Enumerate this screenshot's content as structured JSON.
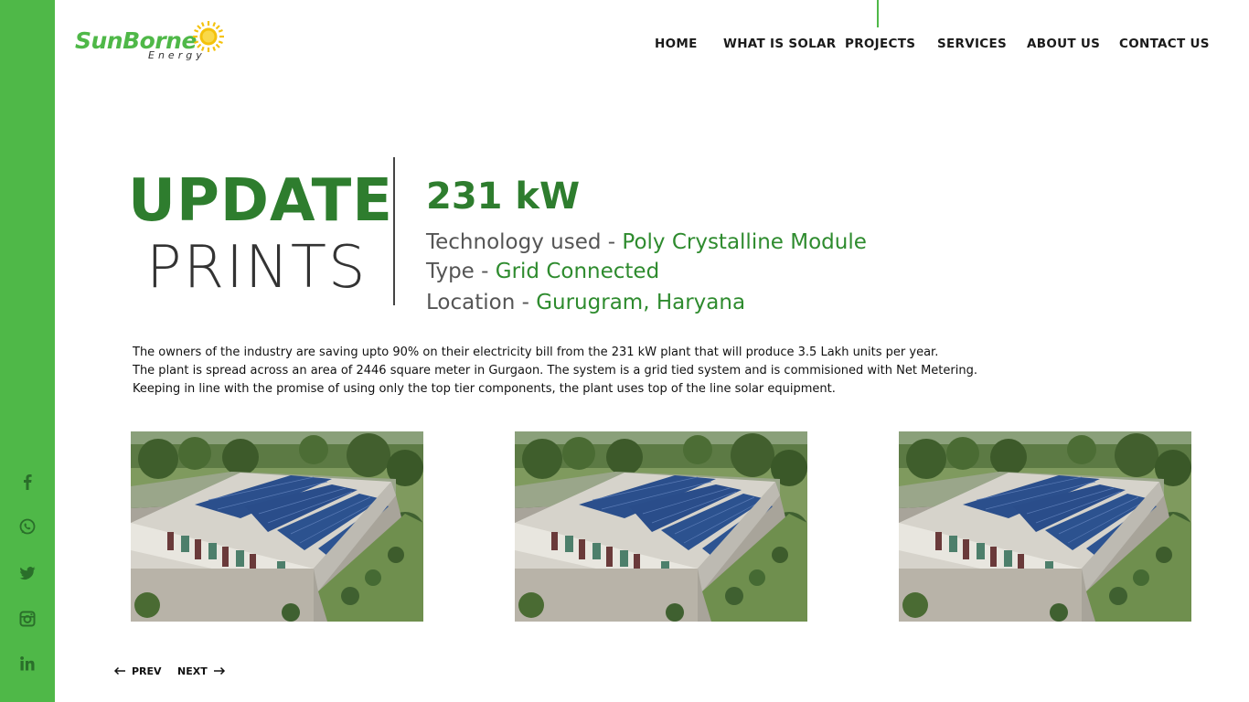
{
  "brand": {
    "name": "SunBorne",
    "tagline": "Energy",
    "accent": "#4fb848",
    "dark_green": "#2e7d2e"
  },
  "nav": [
    {
      "label": "HOME"
    },
    {
      "label": "WHAT IS SOLAR"
    },
    {
      "label": "PROJECTS"
    },
    {
      "label": "SERVICES"
    },
    {
      "label": "ABOUT US"
    },
    {
      "label": "CONTACT US"
    }
  ],
  "active_nav": "PROJECTS",
  "social": [
    "facebook-icon",
    "whatsapp-icon",
    "twitter-icon",
    "instagram-icon",
    "linkedin-icon"
  ],
  "project": {
    "title_line1": "UPDATE",
    "title_line2": "PRINTS",
    "capacity": "231 kW",
    "technology_label": "Technology used - ",
    "technology_value": "Poly Crystalline Module",
    "type_label": "Type - ",
    "type_value": "Grid Connected",
    "location_label": "Location - ",
    "location_value": "Gurugram, Haryana"
  },
  "description": [
    "The owners of the industry are saving upto 90% on their electricity bill from the 231 kW plant that will produce 3.5 Lakh units per year.",
    "The plant is spread across an area of 2446 square meter in Gurgaon. The system is a grid tied system and is commisioned with Net Metering.",
    "Keeping in line with the promise of using only the top tier components, the plant uses top of the line solar equipment."
  ],
  "gallery_count": 3,
  "pager": {
    "prev": "PREV",
    "next": "NEXT"
  }
}
